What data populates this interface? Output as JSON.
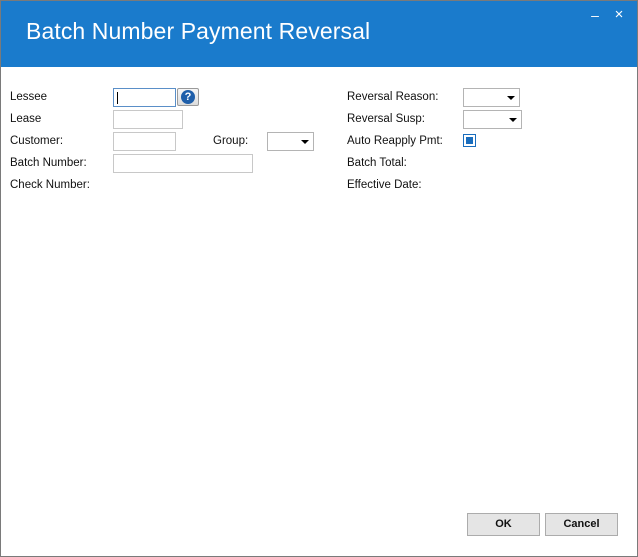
{
  "window": {
    "title": "Batch Number Payment Reversal",
    "minimize_glyph": "–",
    "close_glyph": "×"
  },
  "form": {
    "lessee_label": "Lessee",
    "lessee_value": "",
    "lease_label": "Lease",
    "lease_value": "",
    "customer_label": "Customer:",
    "customer_value": "",
    "group_label": "Group:",
    "group_value": "",
    "batch_number_label": "Batch Number:",
    "batch_number_value": "",
    "check_number_label": "Check Number:",
    "reversal_reason_label": "Reversal Reason:",
    "reversal_reason_value": "",
    "reversal_susp_label": "Reversal Susp:",
    "reversal_susp_value": "",
    "auto_reapply_label": "Auto Reapply Pmt:",
    "auto_reapply_checked": true,
    "batch_total_label": "Batch Total:",
    "effective_date_label": "Effective Date:"
  },
  "icons": {
    "help": "question-mark-icon",
    "help_glyph": "?"
  },
  "buttons": {
    "ok_label": "OK",
    "cancel_label": "Cancel"
  },
  "colors": {
    "titlebar": "#1a7bcc",
    "accent": "#1a6dbd"
  }
}
